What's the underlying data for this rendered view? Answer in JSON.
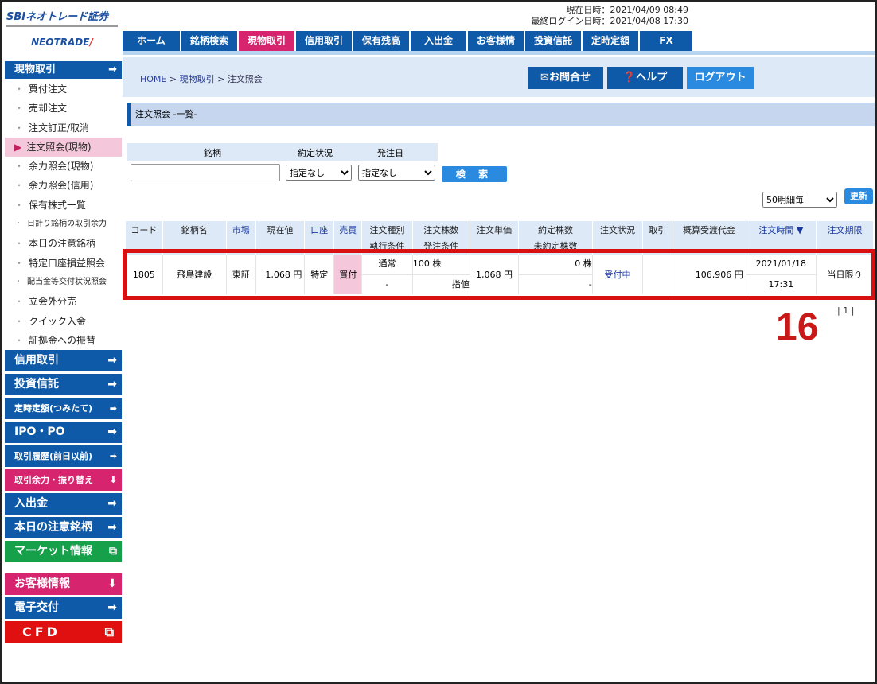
{
  "brand": {
    "logo_top": "SBIネオトレード証券",
    "logo_bottom": "NEOTRADE"
  },
  "header": {
    "current_time": "現在日時：2021/04/09 08:49",
    "last_login": "最終ログイン日時：2021/04/08 17:30"
  },
  "nav": [
    {
      "label": "ホーム"
    },
    {
      "label": "銘柄検索"
    },
    {
      "label": "現物取引",
      "active": true
    },
    {
      "label": "信用取引"
    },
    {
      "label": "保有残高"
    },
    {
      "label": "入出金"
    },
    {
      "label": "お客様情報"
    },
    {
      "label": "投資信託"
    },
    {
      "label": "定時定額"
    },
    {
      "label": "FX"
    }
  ],
  "sidebar": {
    "head": "現物取引",
    "items": [
      {
        "label": "買付注文"
      },
      {
        "label": "売却注文"
      },
      {
        "label": "注文訂正/取消"
      },
      {
        "label": "注文照会(現物)",
        "selected": true
      },
      {
        "label": "余力照会(現物)"
      },
      {
        "label": "余力照会(信用)"
      },
      {
        "label": "保有株式一覧"
      },
      {
        "label": "日計り銘柄の取引余力"
      },
      {
        "label": "本日の注意銘柄"
      },
      {
        "label": "特定口座損益照会"
      },
      {
        "label": "配当金等交付状況照会"
      },
      {
        "label": "立会外分売"
      },
      {
        "label": "クイック入金"
      },
      {
        "label": "証拠金への振替"
      }
    ],
    "buttons": [
      {
        "label": "信用取引",
        "color": "blue"
      },
      {
        "label": "投資信託",
        "color": "blue"
      },
      {
        "label": "定時定額(つみたて)",
        "color": "blue"
      },
      {
        "label": "IPO・PO",
        "color": "blue"
      },
      {
        "label": "取引履歴(前日以前)",
        "color": "blue"
      },
      {
        "label": "取引余力・振り替え",
        "color": "pink"
      },
      {
        "label": "入出金",
        "color": "blue"
      },
      {
        "label": "本日の注意銘柄",
        "color": "blue"
      },
      {
        "label": "マーケット情報",
        "color": "green"
      },
      {
        "label": "お客様情報",
        "color": "pink"
      },
      {
        "label": "電子交付",
        "color": "blue"
      },
      {
        "label": "CFD",
        "color": "red"
      }
    ]
  },
  "breadcrumb": {
    "home": "HOME",
    "sep": " > ",
    "level1": "現物取引",
    "current": "注文照会"
  },
  "top_buttons": {
    "contact": "お問合せ",
    "help": "ヘルプ",
    "logout": "ログアウト"
  },
  "section_title": "注文照会 -一覧-",
  "search": {
    "labels": {
      "stock": "銘柄",
      "status": "約定状況",
      "date": "発注日"
    },
    "stock_value": "",
    "status_value": "指定なし",
    "date_value": "指定なし",
    "button": "検 索"
  },
  "per_page": "50明細毎",
  "refresh": "更新",
  "table": {
    "headers": [
      {
        "l1": "コード"
      },
      {
        "l1": "銘柄名"
      },
      {
        "l1": "市場",
        "blue": true
      },
      {
        "l1": "現在値"
      },
      {
        "l1": "口座",
        "blue": true
      },
      {
        "l1": "売買",
        "blue": true
      },
      {
        "l1": "注文種別",
        "l2": "執行条件"
      },
      {
        "l1": "注文株数",
        "l2": "発注条件"
      },
      {
        "l1": "注文単価"
      },
      {
        "l1": "約定株数",
        "l2": "未約定株数"
      },
      {
        "l1": "注文状況"
      },
      {
        "l1": "取引"
      },
      {
        "l1": "概算受渡代金"
      },
      {
        "l1": "注文時間 ▼",
        "blue": true
      },
      {
        "l1": "注文期限",
        "blue": true
      }
    ],
    "rows": [
      {
        "code": "1805",
        "name": "飛島建設",
        "market": "東証",
        "price": "1,068 円",
        "account": "特定",
        "side": "買付",
        "order_type": "通常",
        "exec_cond": "-",
        "qty": "100 株",
        "order_cond": "指値",
        "unit_price": "1,068 円",
        "filled": "0 株",
        "unfilled": "-",
        "status": "受付中",
        "trade": "",
        "amount": "106,906 円",
        "order_date": "2021/01/18",
        "order_time": "17:31",
        "expiry": "当日限り"
      }
    ]
  },
  "annotation": "16",
  "pagination": "| 1 |",
  "colors": {
    "nav_blue": "#0e5aa8",
    "active_pink": "#d6246e",
    "highlight_red": "#d81010",
    "header_bg": "#dde9f7"
  }
}
